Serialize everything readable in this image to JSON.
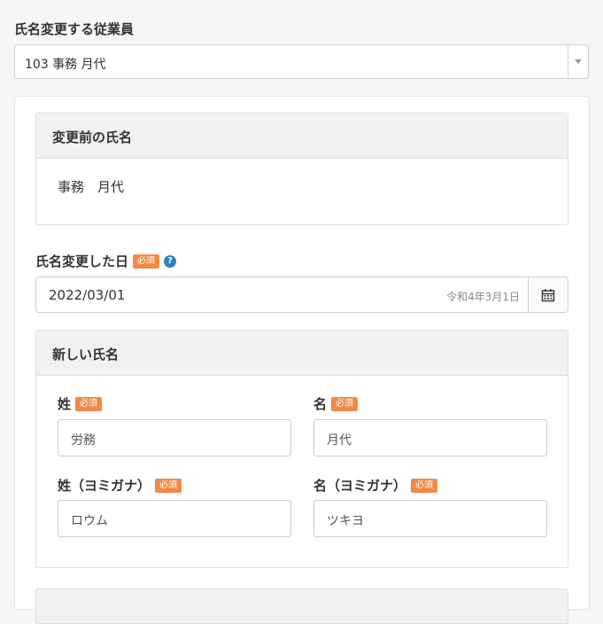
{
  "employee_select": {
    "label": "氏名変更する従業員",
    "value": "103 事務 月代",
    "arrow_icon": "triangle-down"
  },
  "previous_name": {
    "title": "変更前の氏名",
    "value": "事務　月代"
  },
  "change_date": {
    "label": "氏名変更した日",
    "required": "必須",
    "help_icon": "question-circle",
    "value": "2022/03/01",
    "wareki": "令和4年3月1日",
    "calendar_icon": "calendar"
  },
  "new_name": {
    "title": "新しい氏名",
    "required": "必須",
    "last_name_label": "姓",
    "last_name_value": "労務",
    "first_name_label": "名",
    "first_name_value": "月代",
    "last_kana_label": "姓（ヨミガナ）",
    "last_kana_value": "ロウム",
    "first_kana_label": "名（ヨミガナ）",
    "first_kana_value": "ツキヨ"
  },
  "colors": {
    "required_badge": "#f08a46",
    "help_icon": "#2f80c9",
    "background": "#f7f6f5"
  }
}
